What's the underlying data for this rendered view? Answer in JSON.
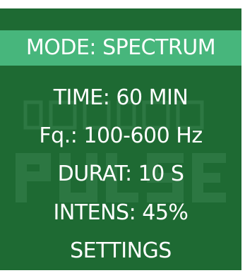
{
  "screen": {
    "background": "#1e6a33",
    "highlight": "#47b67c",
    "text_color": "#ffffff"
  },
  "watermark": {
    "line1": "INFINIA",
    "line2": "PULSE"
  },
  "menu": {
    "items": [
      {
        "label": "MODE: SPECTRUM",
        "selected": true
      },
      {
        "label": "TIME: 60 MIN",
        "selected": false
      },
      {
        "label": "Fq.: 100-600 Hz",
        "selected": false
      },
      {
        "label": "DURAT: 10 S",
        "selected": false
      },
      {
        "label": "INTENS: 45%",
        "selected": false
      },
      {
        "label": "SETTINGS",
        "selected": false
      }
    ]
  }
}
